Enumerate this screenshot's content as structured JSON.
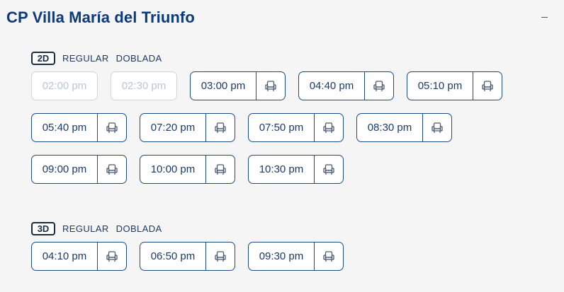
{
  "cinema": {
    "title": "CP Villa María del Triunfo",
    "collapse_label": "−"
  },
  "colors": {
    "brand": "#0d3a7a",
    "border": "#1d4b88",
    "disabled": "#c9d6e2"
  },
  "formats": [
    {
      "badge": "2D",
      "tags": [
        "REGULAR",
        "DOBLADA"
      ],
      "showtimes": [
        {
          "time": "02:00 pm",
          "available": false
        },
        {
          "time": "02:30 pm",
          "available": false
        },
        {
          "time": "03:00 pm",
          "available": true,
          "icon": "seat-icon"
        },
        {
          "time": "04:40 pm",
          "available": true,
          "icon": "seat-icon"
        },
        {
          "time": "05:10 pm",
          "available": true,
          "icon": "seat-icon"
        },
        {
          "time": "05:40 pm",
          "available": true,
          "icon": "seat-icon"
        },
        {
          "time": "07:20 pm",
          "available": true,
          "icon": "seat-icon"
        },
        {
          "time": "07:50 pm",
          "available": true,
          "icon": "seat-icon"
        },
        {
          "time": "08:30 pm",
          "available": true,
          "icon": "seat-icon"
        },
        {
          "time": "09:00 pm",
          "available": true,
          "icon": "seat-icon"
        },
        {
          "time": "10:00 pm",
          "available": true,
          "icon": "seat-icon"
        },
        {
          "time": "10:30 pm",
          "available": true,
          "icon": "seat-icon"
        }
      ]
    },
    {
      "badge": "3D",
      "tags": [
        "REGULAR",
        "DOBLADA"
      ],
      "showtimes": [
        {
          "time": "04:10 pm",
          "available": true,
          "icon": "seat-icon"
        },
        {
          "time": "06:50 pm",
          "available": true,
          "icon": "seat-icon"
        },
        {
          "time": "09:30 pm",
          "available": true,
          "icon": "seat-icon"
        }
      ]
    }
  ]
}
